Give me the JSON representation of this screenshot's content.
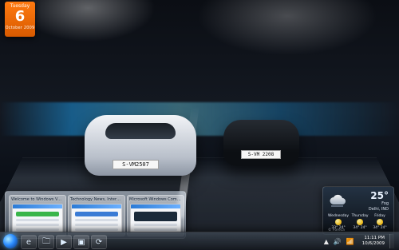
{
  "desktop": {
    "plates": {
      "left_car": "S-VM2507",
      "right_car": "S-VM 2208"
    }
  },
  "gadgets": {
    "calendar": {
      "day": "Tuesday",
      "date": "6",
      "month_year": "October 2009"
    },
    "weather": {
      "temperature": "25°",
      "condition": "Fog",
      "location": "Delhi, IND",
      "forecast": [
        {
          "day": "Wednesday",
          "temps": "33° 24°"
        },
        {
          "day": "Thursday",
          "temps": "34° 24°"
        },
        {
          "day": "Friday",
          "temps": "34° 24°"
        }
      ],
      "credit": "© Foreca"
    }
  },
  "taskbar": {
    "thumbnails": [
      {
        "title": "Welcome to Windows Valley |..."
      },
      {
        "title": "Technology News, Internet, Tip..."
      },
      {
        "title": "Microsoft Windows Commun..."
      }
    ],
    "pinned": [
      {
        "icon": "ie-icon",
        "label": "e"
      },
      {
        "icon": "folder-icon",
        "label": "🗀"
      },
      {
        "icon": "media-player-icon",
        "label": "▶"
      },
      {
        "icon": "app-icon",
        "label": "▣"
      },
      {
        "icon": "network-icon",
        "label": "⟳"
      }
    ],
    "clock": {
      "time": "11:11 PM",
      "date": "10/6/2009"
    }
  }
}
